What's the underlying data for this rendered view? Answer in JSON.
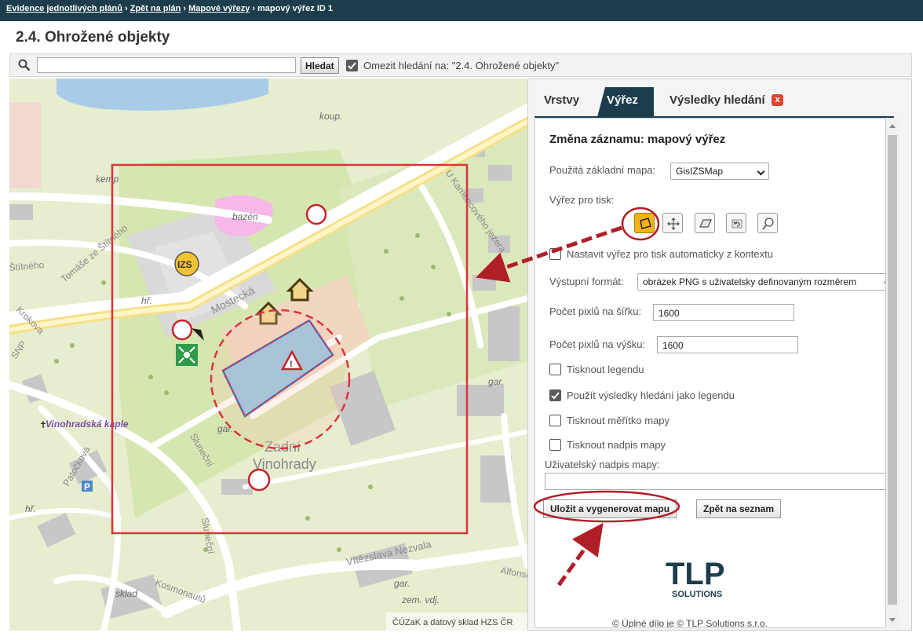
{
  "breadcrumb": {
    "items": [
      "Evidence jednotlivých plánů",
      "Zpět na plán",
      "Mapové výřezy"
    ],
    "current": "mapový výřez ID 1",
    "sep": "›"
  },
  "page_title": "2.4. Ohrožené objekty",
  "search": {
    "value": "",
    "placeholder": "",
    "button_label": "Hledat",
    "limit_checked": true,
    "limit_label": "Omezit hledání na: \"2.4. Ohrožené objekty\""
  },
  "map": {
    "labels": {
      "koup": "koup.",
      "kemp": "kemp",
      "bazen": "bazén",
      "izs": "IZS",
      "stitneho": "Štítného",
      "tomase": "Tomáše ze Štítného",
      "mostecka": "Mostecká",
      "hr1": "hř.",
      "krokova": "Krokova",
      "snp": "SNP",
      "vinohradska": "Vinohradská kaple",
      "gar1": "gar.",
      "gar2": "gar.",
      "gar3": "gar.",
      "slunecni1": "Sluneční",
      "slunecni2": "Sluneční",
      "patockova": "Patočkova",
      "hr2": "hř.",
      "zadni1": "Zadní",
      "zadni2": "Vinohrady",
      "kamenc": "U Kamencového jezera",
      "vitezslava": "Vítězslava Nezvala",
      "alfons": "Alfonse Muchy",
      "zem": "zem. vdj.",
      "sklad": "sklad",
      "kosmonautu": "Kosmonautů",
      "skl": "sklad",
      "parking": "P",
      "attribution": "ČÚZaK a datový sklad HZS ČR"
    }
  },
  "panel": {
    "tabs": [
      "Vrstvy",
      "Výřez",
      "Výsledky hledání"
    ],
    "active_tab": "Výřez",
    "close_symbol": "x",
    "form_title": "Změna záznamu: mapový výřez",
    "base_map_label": "Použitá základní mapa:",
    "base_map_value": "GisIZSMap",
    "clip_label": "Výřez pro tisk:",
    "tools": [
      "draw-rectangle-icon",
      "pan-icon",
      "erase-icon",
      "undo-icon",
      "zoom-icon"
    ],
    "auto_clip_label": "Nastavit výřez pro tisk automaticky z kontextu",
    "auto_clip_checked": false,
    "output_format_label": "Výstupní formát:",
    "output_format_value": "obrázek PNG s uživatelsky definovaným rozměrem",
    "width_label": "Počet pixlů na šířku:",
    "width_value": "1600",
    "height_label": "Počet pixlů na výšku:",
    "height_value": "1600",
    "print_legend_label": "Tisknout legendu",
    "print_legend_checked": false,
    "use_results_label": "Použít výsledky hledání jako legendu",
    "use_results_checked": true,
    "print_scale_label": "Tisknout měřítko mapy",
    "print_scale_checked": false,
    "print_title_label": "Tisknout nadpis mapy",
    "print_title_checked": false,
    "user_title_label": "Uživatelský nadpis mapy:",
    "user_title_value": "",
    "save_button": "Uložit a vygenerovat mapu",
    "back_button": "Zpět na seznam",
    "logo_main": "TLP",
    "logo_sub": "SOLUTIONS",
    "copyright": "© Úplné dílo je © TLP Solutions s.r.o."
  },
  "colors": {
    "header_bg": "#1d3d4d",
    "accent_red": "#c8232c",
    "active_tool": "#f2b21a"
  }
}
